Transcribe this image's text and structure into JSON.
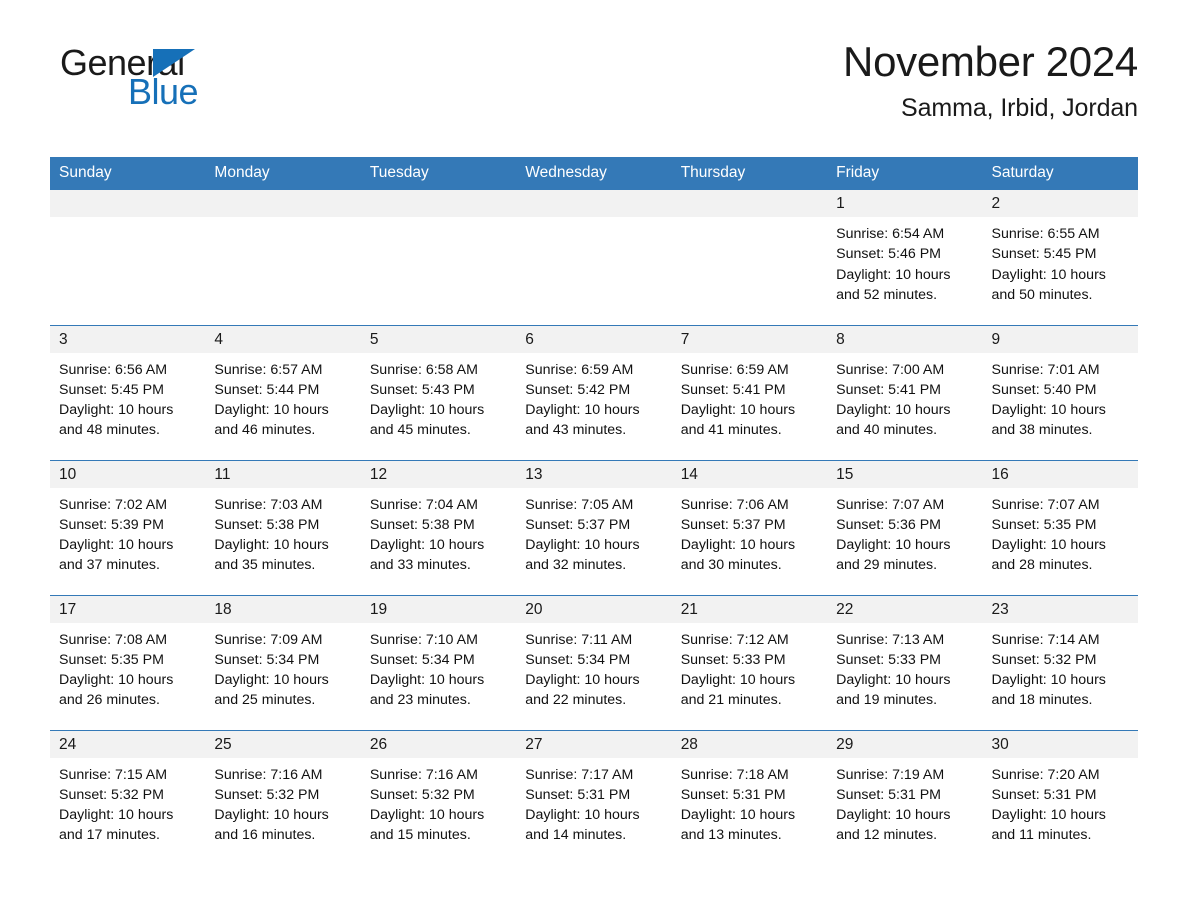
{
  "brand": {
    "name_part1": "General",
    "name_part2": "Blue",
    "accent_color": "#1670b8",
    "triangle_icon": "triangle-icon"
  },
  "header": {
    "title": "November 2024",
    "subtitle": "Samma, Irbid, Jordan"
  },
  "calendar": {
    "header_bg": "#3479b7",
    "header_text_color": "#ffffff",
    "daynum_band_bg": "#f2f2f2",
    "weekdays": [
      "Sunday",
      "Monday",
      "Tuesday",
      "Wednesday",
      "Thursday",
      "Friday",
      "Saturday"
    ],
    "weeks": [
      [
        {
          "day": "",
          "lines": []
        },
        {
          "day": "",
          "lines": []
        },
        {
          "day": "",
          "lines": []
        },
        {
          "day": "",
          "lines": []
        },
        {
          "day": "",
          "lines": []
        },
        {
          "day": "1",
          "lines": [
            "Sunrise: 6:54 AM",
            "Sunset: 5:46 PM",
            "Daylight: 10 hours",
            "and 52 minutes."
          ]
        },
        {
          "day": "2",
          "lines": [
            "Sunrise: 6:55 AM",
            "Sunset: 5:45 PM",
            "Daylight: 10 hours",
            "and 50 minutes."
          ]
        }
      ],
      [
        {
          "day": "3",
          "lines": [
            "Sunrise: 6:56 AM",
            "Sunset: 5:45 PM",
            "Daylight: 10 hours",
            "and 48 minutes."
          ]
        },
        {
          "day": "4",
          "lines": [
            "Sunrise: 6:57 AM",
            "Sunset: 5:44 PM",
            "Daylight: 10 hours",
            "and 46 minutes."
          ]
        },
        {
          "day": "5",
          "lines": [
            "Sunrise: 6:58 AM",
            "Sunset: 5:43 PM",
            "Daylight: 10 hours",
            "and 45 minutes."
          ]
        },
        {
          "day": "6",
          "lines": [
            "Sunrise: 6:59 AM",
            "Sunset: 5:42 PM",
            "Daylight: 10 hours",
            "and 43 minutes."
          ]
        },
        {
          "day": "7",
          "lines": [
            "Sunrise: 6:59 AM",
            "Sunset: 5:41 PM",
            "Daylight: 10 hours",
            "and 41 minutes."
          ]
        },
        {
          "day": "8",
          "lines": [
            "Sunrise: 7:00 AM",
            "Sunset: 5:41 PM",
            "Daylight: 10 hours",
            "and 40 minutes."
          ]
        },
        {
          "day": "9",
          "lines": [
            "Sunrise: 7:01 AM",
            "Sunset: 5:40 PM",
            "Daylight: 10 hours",
            "and 38 minutes."
          ]
        }
      ],
      [
        {
          "day": "10",
          "lines": [
            "Sunrise: 7:02 AM",
            "Sunset: 5:39 PM",
            "Daylight: 10 hours",
            "and 37 minutes."
          ]
        },
        {
          "day": "11",
          "lines": [
            "Sunrise: 7:03 AM",
            "Sunset: 5:38 PM",
            "Daylight: 10 hours",
            "and 35 minutes."
          ]
        },
        {
          "day": "12",
          "lines": [
            "Sunrise: 7:04 AM",
            "Sunset: 5:38 PM",
            "Daylight: 10 hours",
            "and 33 minutes."
          ]
        },
        {
          "day": "13",
          "lines": [
            "Sunrise: 7:05 AM",
            "Sunset: 5:37 PM",
            "Daylight: 10 hours",
            "and 32 minutes."
          ]
        },
        {
          "day": "14",
          "lines": [
            "Sunrise: 7:06 AM",
            "Sunset: 5:37 PM",
            "Daylight: 10 hours",
            "and 30 minutes."
          ]
        },
        {
          "day": "15",
          "lines": [
            "Sunrise: 7:07 AM",
            "Sunset: 5:36 PM",
            "Daylight: 10 hours",
            "and 29 minutes."
          ]
        },
        {
          "day": "16",
          "lines": [
            "Sunrise: 7:07 AM",
            "Sunset: 5:35 PM",
            "Daylight: 10 hours",
            "and 28 minutes."
          ]
        }
      ],
      [
        {
          "day": "17",
          "lines": [
            "Sunrise: 7:08 AM",
            "Sunset: 5:35 PM",
            "Daylight: 10 hours",
            "and 26 minutes."
          ]
        },
        {
          "day": "18",
          "lines": [
            "Sunrise: 7:09 AM",
            "Sunset: 5:34 PM",
            "Daylight: 10 hours",
            "and 25 minutes."
          ]
        },
        {
          "day": "19",
          "lines": [
            "Sunrise: 7:10 AM",
            "Sunset: 5:34 PM",
            "Daylight: 10 hours",
            "and 23 minutes."
          ]
        },
        {
          "day": "20",
          "lines": [
            "Sunrise: 7:11 AM",
            "Sunset: 5:34 PM",
            "Daylight: 10 hours",
            "and 22 minutes."
          ]
        },
        {
          "day": "21",
          "lines": [
            "Sunrise: 7:12 AM",
            "Sunset: 5:33 PM",
            "Daylight: 10 hours",
            "and 21 minutes."
          ]
        },
        {
          "day": "22",
          "lines": [
            "Sunrise: 7:13 AM",
            "Sunset: 5:33 PM",
            "Daylight: 10 hours",
            "and 19 minutes."
          ]
        },
        {
          "day": "23",
          "lines": [
            "Sunrise: 7:14 AM",
            "Sunset: 5:32 PM",
            "Daylight: 10 hours",
            "and 18 minutes."
          ]
        }
      ],
      [
        {
          "day": "24",
          "lines": [
            "Sunrise: 7:15 AM",
            "Sunset: 5:32 PM",
            "Daylight: 10 hours",
            "and 17 minutes."
          ]
        },
        {
          "day": "25",
          "lines": [
            "Sunrise: 7:16 AM",
            "Sunset: 5:32 PM",
            "Daylight: 10 hours",
            "and 16 minutes."
          ]
        },
        {
          "day": "26",
          "lines": [
            "Sunrise: 7:16 AM",
            "Sunset: 5:32 PM",
            "Daylight: 10 hours",
            "and 15 minutes."
          ]
        },
        {
          "day": "27",
          "lines": [
            "Sunrise: 7:17 AM",
            "Sunset: 5:31 PM",
            "Daylight: 10 hours",
            "and 14 minutes."
          ]
        },
        {
          "day": "28",
          "lines": [
            "Sunrise: 7:18 AM",
            "Sunset: 5:31 PM",
            "Daylight: 10 hours",
            "and 13 minutes."
          ]
        },
        {
          "day": "29",
          "lines": [
            "Sunrise: 7:19 AM",
            "Sunset: 5:31 PM",
            "Daylight: 10 hours",
            "and 12 minutes."
          ]
        },
        {
          "day": "30",
          "lines": [
            "Sunrise: 7:20 AM",
            "Sunset: 5:31 PM",
            "Daylight: 10 hours",
            "and 11 minutes."
          ]
        }
      ]
    ]
  }
}
